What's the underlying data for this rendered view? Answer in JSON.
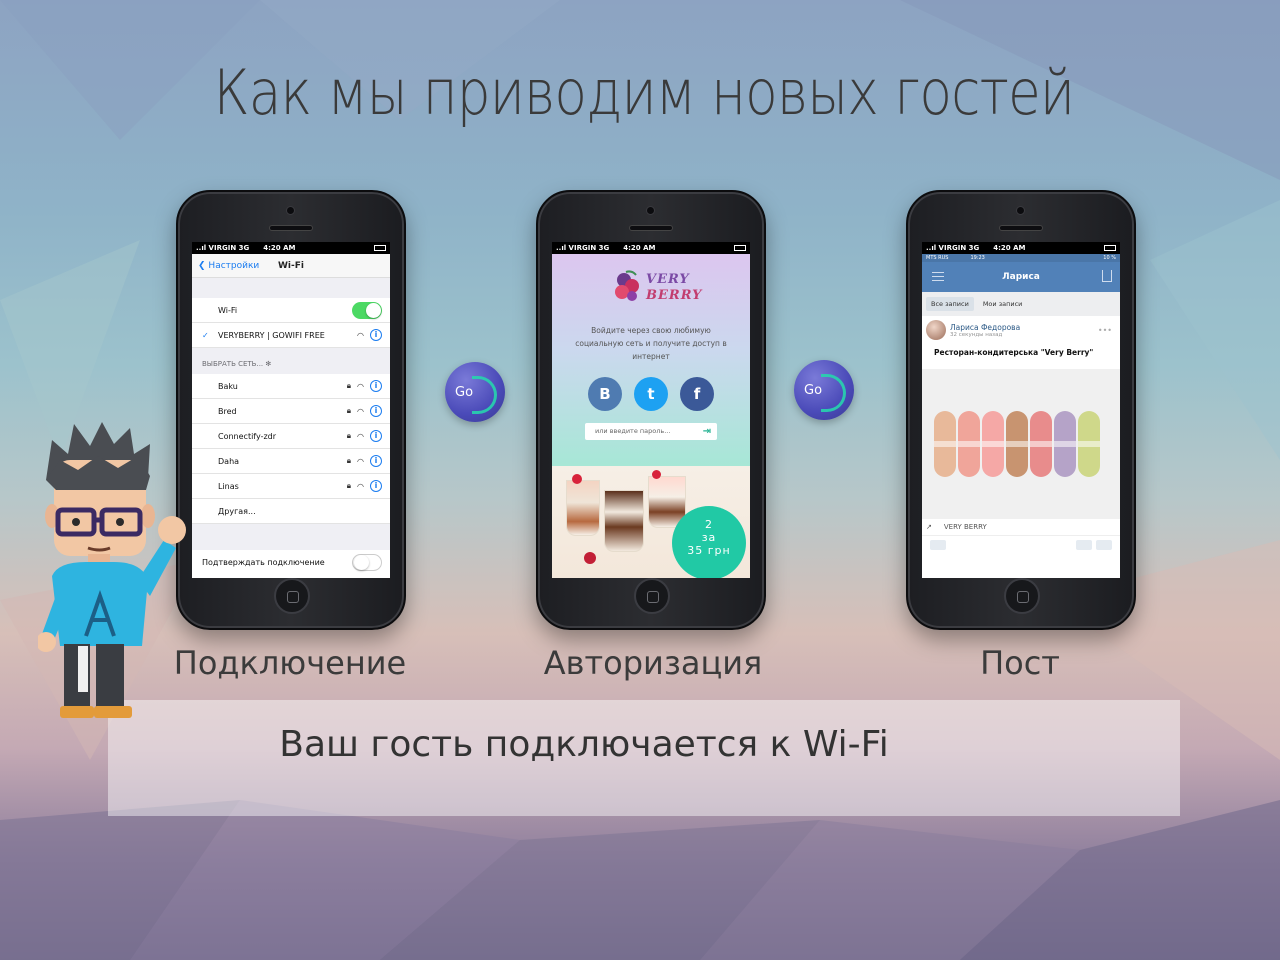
{
  "title": "Как мы приводим новых гостей",
  "steps": [
    {
      "caption": "Подключение"
    },
    {
      "caption": "Авторизация"
    },
    {
      "caption": "Пост"
    }
  ],
  "banner": "Ваш гость подключается к Wi-Fi",
  "go_icon_label": "Go",
  "phone1": {
    "status": {
      "carrier": "..ıl VIRGIN  3G",
      "time": "4:20 AM"
    },
    "back_label": "Настройки",
    "nav_title": "Wi-Fi",
    "wifi_label": "Wi-Fi",
    "connected_network": "VERYBERRY | GOWIFI FREE",
    "choose_network_label": "ВЫБРАТЬ СЕТЬ...",
    "networks": [
      "Baku",
      "Bred",
      "Connectify-zdr",
      "Daha",
      "Linas"
    ],
    "other_label": "Другая...",
    "ask_join_label": "Подтверждать подключение"
  },
  "phone2": {
    "status": {
      "carrier": "..ıl VIRGIN  3G",
      "time": "4:20 AM"
    },
    "logo_line1": "VERY",
    "logo_line2": "BERRY",
    "message": "Войдите через свою любимую социальную сеть и получите доступ в интернет",
    "social_buttons": [
      "B",
      "t",
      "f"
    ],
    "password_placeholder": "или введите пароль...",
    "promo_line1": "2",
    "promo_line2": "за",
    "promo_line3": "35 грн"
  },
  "phone3": {
    "status": {
      "carrier": "..ıl VIRGIN  3G",
      "time": "4:20 AM"
    },
    "inner_status": {
      "carrier": "MTS RUS",
      "time": "19:23",
      "battery": "10 %"
    },
    "header_title": "Лариса",
    "tabs": [
      "Все записи",
      "Мои записи"
    ],
    "author": "Лариса Федорова",
    "post_time": "32 секунды назад",
    "post_text": "Ресторан-кондитерська \"Very Berry\"",
    "link_label": "VERY BERRY"
  },
  "colors": {
    "ios_blue": "#1a7cf0",
    "ios_green": "#4cd964",
    "vk_blue": "#5181b8",
    "vk_blue_dark": "#4a76a8",
    "vk_name": "#2a5885",
    "mint": "#21c9a5",
    "vk_button": "#3b5998",
    "twitter": "#1da1f2",
    "facebook": "#3b5998"
  },
  "icons": [
    "back-chevron-icon",
    "checkmark-icon",
    "wifi-icon",
    "lock-icon",
    "info-icon",
    "spinner-icon",
    "enter-arrow-icon",
    "menu-icon",
    "share-icon",
    "repost-icon",
    "like-icon",
    "comment-icon",
    "go-wifi-logo-icon"
  ]
}
